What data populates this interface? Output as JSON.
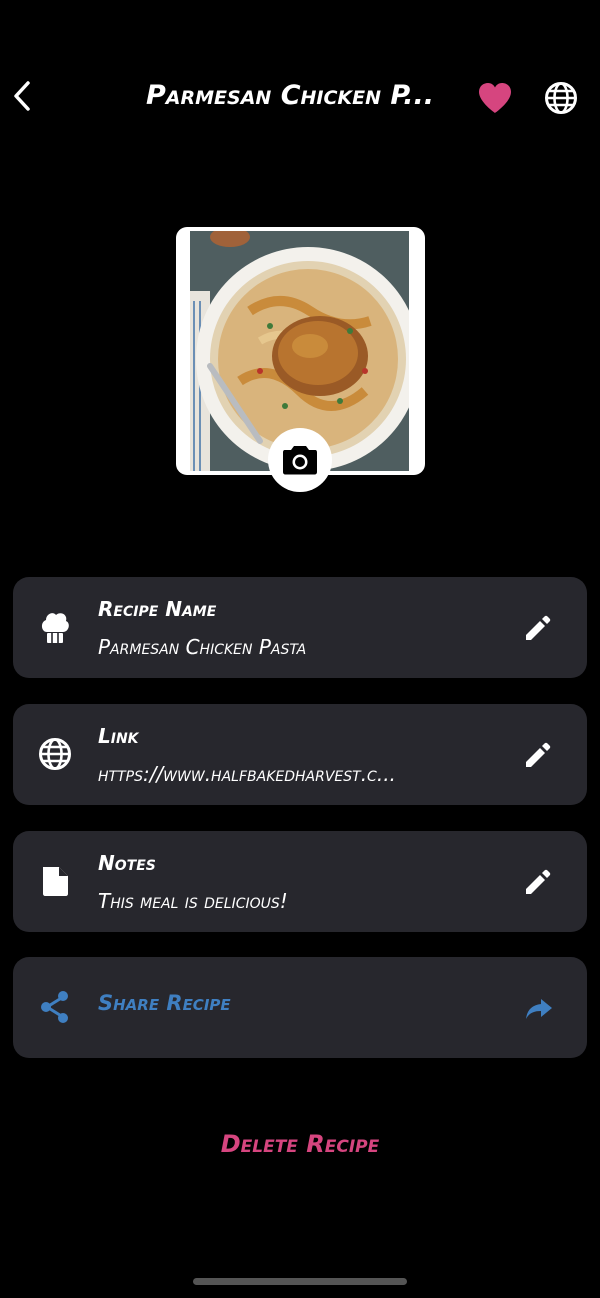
{
  "header": {
    "title": "Parmesan Chicken P...",
    "back_icon": "chevron-left-icon",
    "favorite_icon": "heart-icon",
    "web_icon": "globe-icon"
  },
  "photo": {
    "camera_icon": "camera-icon"
  },
  "fields": [
    {
      "label": "Recipe Name",
      "value": "Parmesan Chicken Pasta",
      "icon": "chef-hat-icon"
    },
    {
      "label": "Link",
      "value": "https://www.halfbakedharvest.c...",
      "icon": "globe-icon"
    },
    {
      "label": "Notes",
      "value": "This meal is delicious!",
      "icon": "note-icon"
    }
  ],
  "share": {
    "label": "Share Recipe",
    "icon": "share-icon",
    "arrow_icon": "forward-arrow-icon"
  },
  "delete_label": "Delete Recipe",
  "colors": {
    "background": "#000000",
    "card": "#27272d",
    "accent_pink": "#d6457f",
    "accent_blue": "#3f7fc1",
    "text": "#ffffff"
  }
}
